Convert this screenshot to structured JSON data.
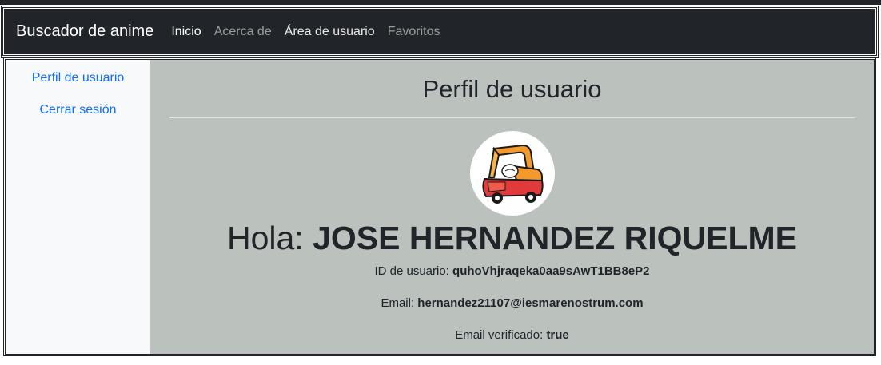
{
  "navbar": {
    "brand": "Buscador de anime",
    "links": [
      {
        "label": "Inicio"
      },
      {
        "label": "Acerca de"
      },
      {
        "label": "Área de usuario"
      },
      {
        "label": "Favoritos"
      }
    ]
  },
  "sidebar": {
    "items": [
      {
        "label": "Perfil de usuario"
      },
      {
        "label": "Cerrar sesión"
      }
    ]
  },
  "main": {
    "title": "Perfil de usuario",
    "greeting_prefix": "Hola: ",
    "user_name": "JOSE HERNANDEZ RIQUELME",
    "user_id_label": "ID de usuario: ",
    "user_id": "quhoVhjraqeka0aa9sAwT1BB8eP2",
    "email_label": "Email: ",
    "email": "hernandez21107@iesmarenostrum.com",
    "verified_label": "Email verificado: ",
    "verified": "true"
  },
  "colors": {
    "navbar_bg": "#212529",
    "sidebar_bg": "#f8f9fa",
    "main_bg": "#bbc1bd",
    "link": "#0d6efd"
  }
}
